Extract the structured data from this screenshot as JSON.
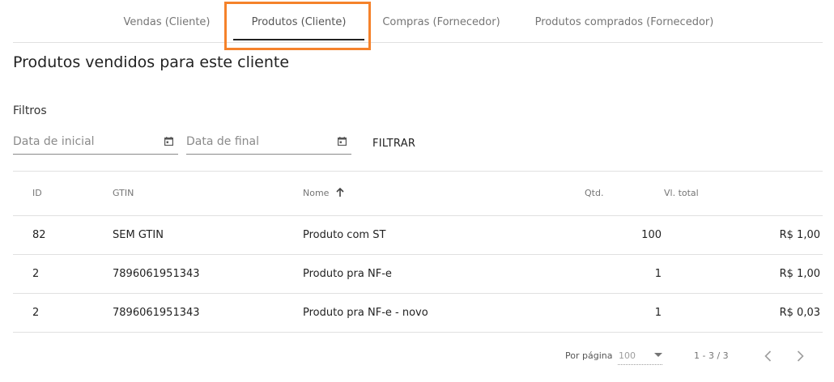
{
  "tabs": [
    {
      "label": "Vendas (Cliente)",
      "active": false
    },
    {
      "label": "Produtos (Cliente)",
      "active": true
    },
    {
      "label": "Compras (Fornecedor)",
      "active": false
    },
    {
      "label": "Produtos comprados (Fornecedor)",
      "active": false
    }
  ],
  "page_title": "Produtos vendidos para este cliente",
  "filters": {
    "label": "Filtros",
    "start_date": {
      "placeholder": "Data de inicial",
      "value": ""
    },
    "end_date": {
      "placeholder": "Data de final",
      "value": ""
    },
    "filter_button": "FILTRAR"
  },
  "table": {
    "headers": {
      "id": "ID",
      "gtin": "GTIN",
      "nome": "Nome",
      "qtd": "Qtd.",
      "vl_total": "Vl. total"
    },
    "sort": {
      "column": "nome",
      "direction": "asc"
    },
    "rows": [
      {
        "id": "82",
        "gtin": "SEM GTIN",
        "nome": "Produto com ST",
        "qtd": "100",
        "vl_total": "R$ 1,00"
      },
      {
        "id": "2",
        "gtin": "7896061951343",
        "nome": "Produto pra NF-e",
        "qtd": "1",
        "vl_total": "R$ 1,00"
      },
      {
        "id": "2",
        "gtin": "7896061951343",
        "nome": "Produto pra NF-e - novo",
        "qtd": "1",
        "vl_total": "R$ 0,03"
      }
    ]
  },
  "pagination": {
    "per_page_label": "Por página",
    "per_page_value": "100",
    "range": "1 - 3 / 3",
    "prev_icon": "chevron-left-icon",
    "next_icon": "chevron-right-icon"
  },
  "colors": {
    "highlight": "#f5822b",
    "active_tab_underline": "#222222",
    "divider": "#e0e0e0"
  }
}
